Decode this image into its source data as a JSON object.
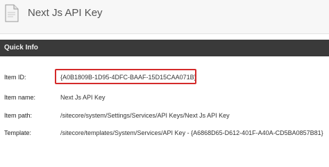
{
  "item": {
    "icon": "api-key-item-icon",
    "title": "Next Js API Key"
  },
  "section": {
    "title": "Quick Info"
  },
  "fields": [
    {
      "label": "Item ID:",
      "value": "{A0B1809B-1D95-4DFC-BAAF-15D15CAA071B}"
    },
    {
      "label": "Item name:",
      "value": "Next Js API Key"
    },
    {
      "label": "Item path:",
      "value": "/sitecore/system/Settings/Services/API Keys/Next Js API Key"
    },
    {
      "label": "Template:",
      "value": "/sitecore/templates/System/Services/API Key - {A6868D65-D612-401F-A40A-CD5BA0857B81}"
    }
  ],
  "colors": {
    "highlight": "#d42a2a",
    "section_bar": "#3a3a3a"
  }
}
